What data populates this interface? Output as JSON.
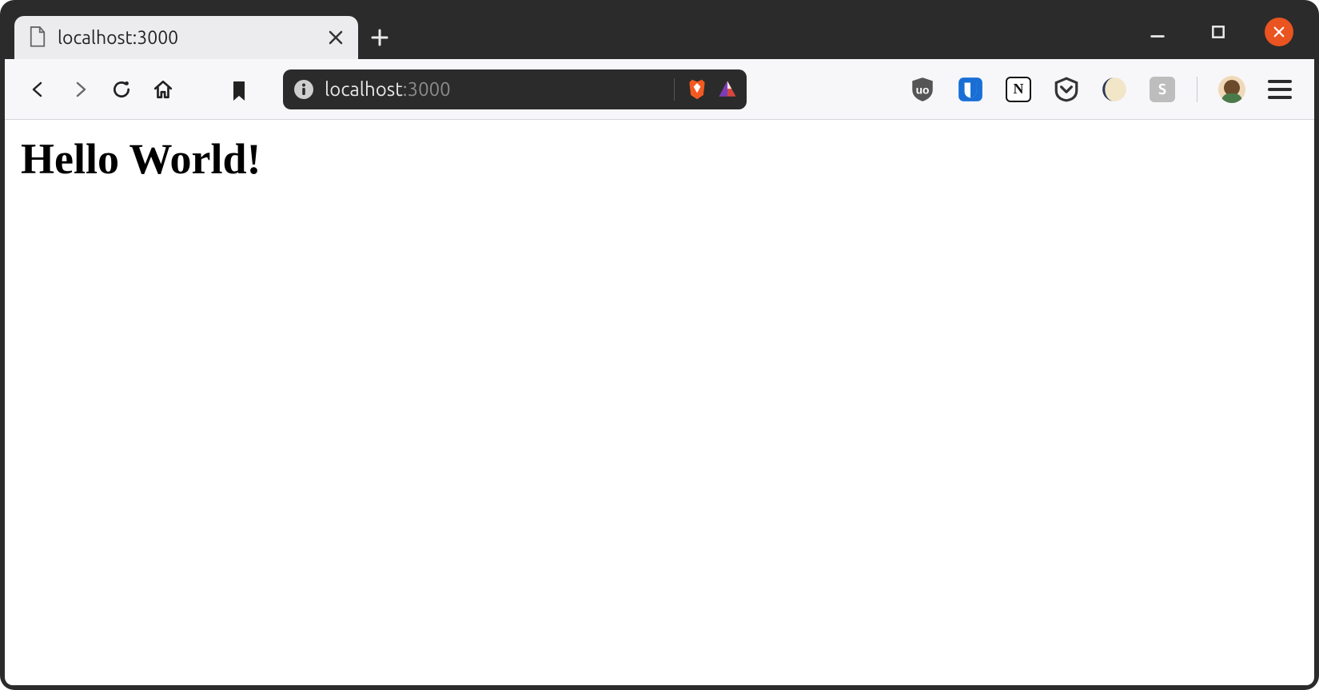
{
  "tab": {
    "title": "localhost:3000"
  },
  "url": {
    "host": "localhost",
    "suffix": ":3000"
  },
  "extensions": {
    "ublock_label": "uo",
    "notion_label": "N",
    "s_label": "S"
  },
  "page": {
    "heading": "Hello World!"
  }
}
